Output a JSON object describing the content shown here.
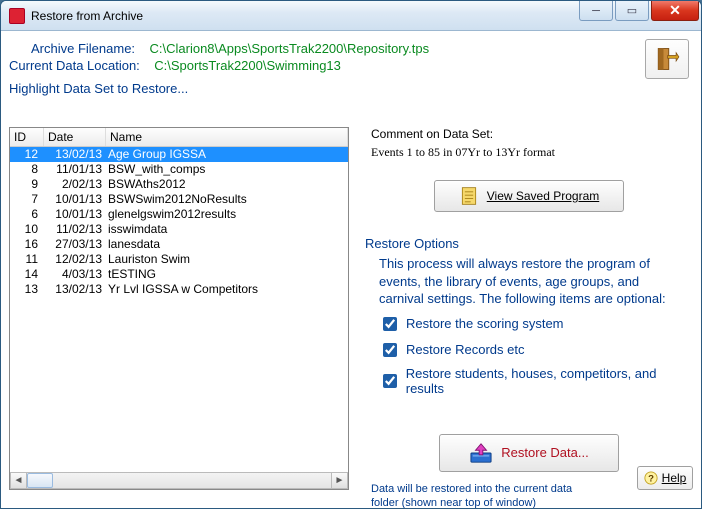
{
  "window": {
    "title": "Restore from Archive"
  },
  "header": {
    "archive_label": "Archive Filename:",
    "archive_value": "C:\\Clarion8\\Apps\\SportsTrak2200\\Repository.tps",
    "location_label": "Current Data Location:",
    "location_value": "C:\\SportsTrak2200\\Swimming13"
  },
  "section_label": "Highlight Data Set to Restore...",
  "list": {
    "headers": {
      "id": "ID",
      "date": "Date",
      "name": "Name"
    },
    "rows": [
      {
        "id": "12",
        "date": "13/02/13",
        "name": "Age Group IGSSA",
        "selected": true
      },
      {
        "id": "8",
        "date": "11/01/13",
        "name": "BSW_with_comps"
      },
      {
        "id": "9",
        "date": "2/02/13",
        "name": "BSWAths2012"
      },
      {
        "id": "7",
        "date": "10/01/13",
        "name": "BSWSwim2012NoResults"
      },
      {
        "id": "6",
        "date": "10/01/13",
        "name": "glenelgswim2012results"
      },
      {
        "id": "10",
        "date": "11/02/13",
        "name": "isswimdata"
      },
      {
        "id": "16",
        "date": "27/03/13",
        "name": "lanesdata"
      },
      {
        "id": "11",
        "date": "12/02/13",
        "name": "Lauriston Swim"
      },
      {
        "id": "14",
        "date": "4/03/13",
        "name": "tESTING"
      },
      {
        "id": "13",
        "date": "13/02/13",
        "name": "Yr Lvl IGSSA w Competitors"
      }
    ]
  },
  "comment": {
    "label": "Comment on Data Set:",
    "value": "Events 1 to 85 in 07Yr to 13Yr format"
  },
  "view_button": "View Saved Program",
  "restore_options": {
    "title": "Restore Options",
    "description": "This process will always restore the program of events, the library of events, age groups, and carnival settings. The following items are optional:",
    "chk1": "Restore the scoring system",
    "chk2": "Restore Records etc",
    "chk3": "Restore students, houses, competitors, and results"
  },
  "restore_button": "Restore Data...",
  "restore_note": "Data will be restored into the current data folder (shown near top of window)",
  "help_button": "Help"
}
